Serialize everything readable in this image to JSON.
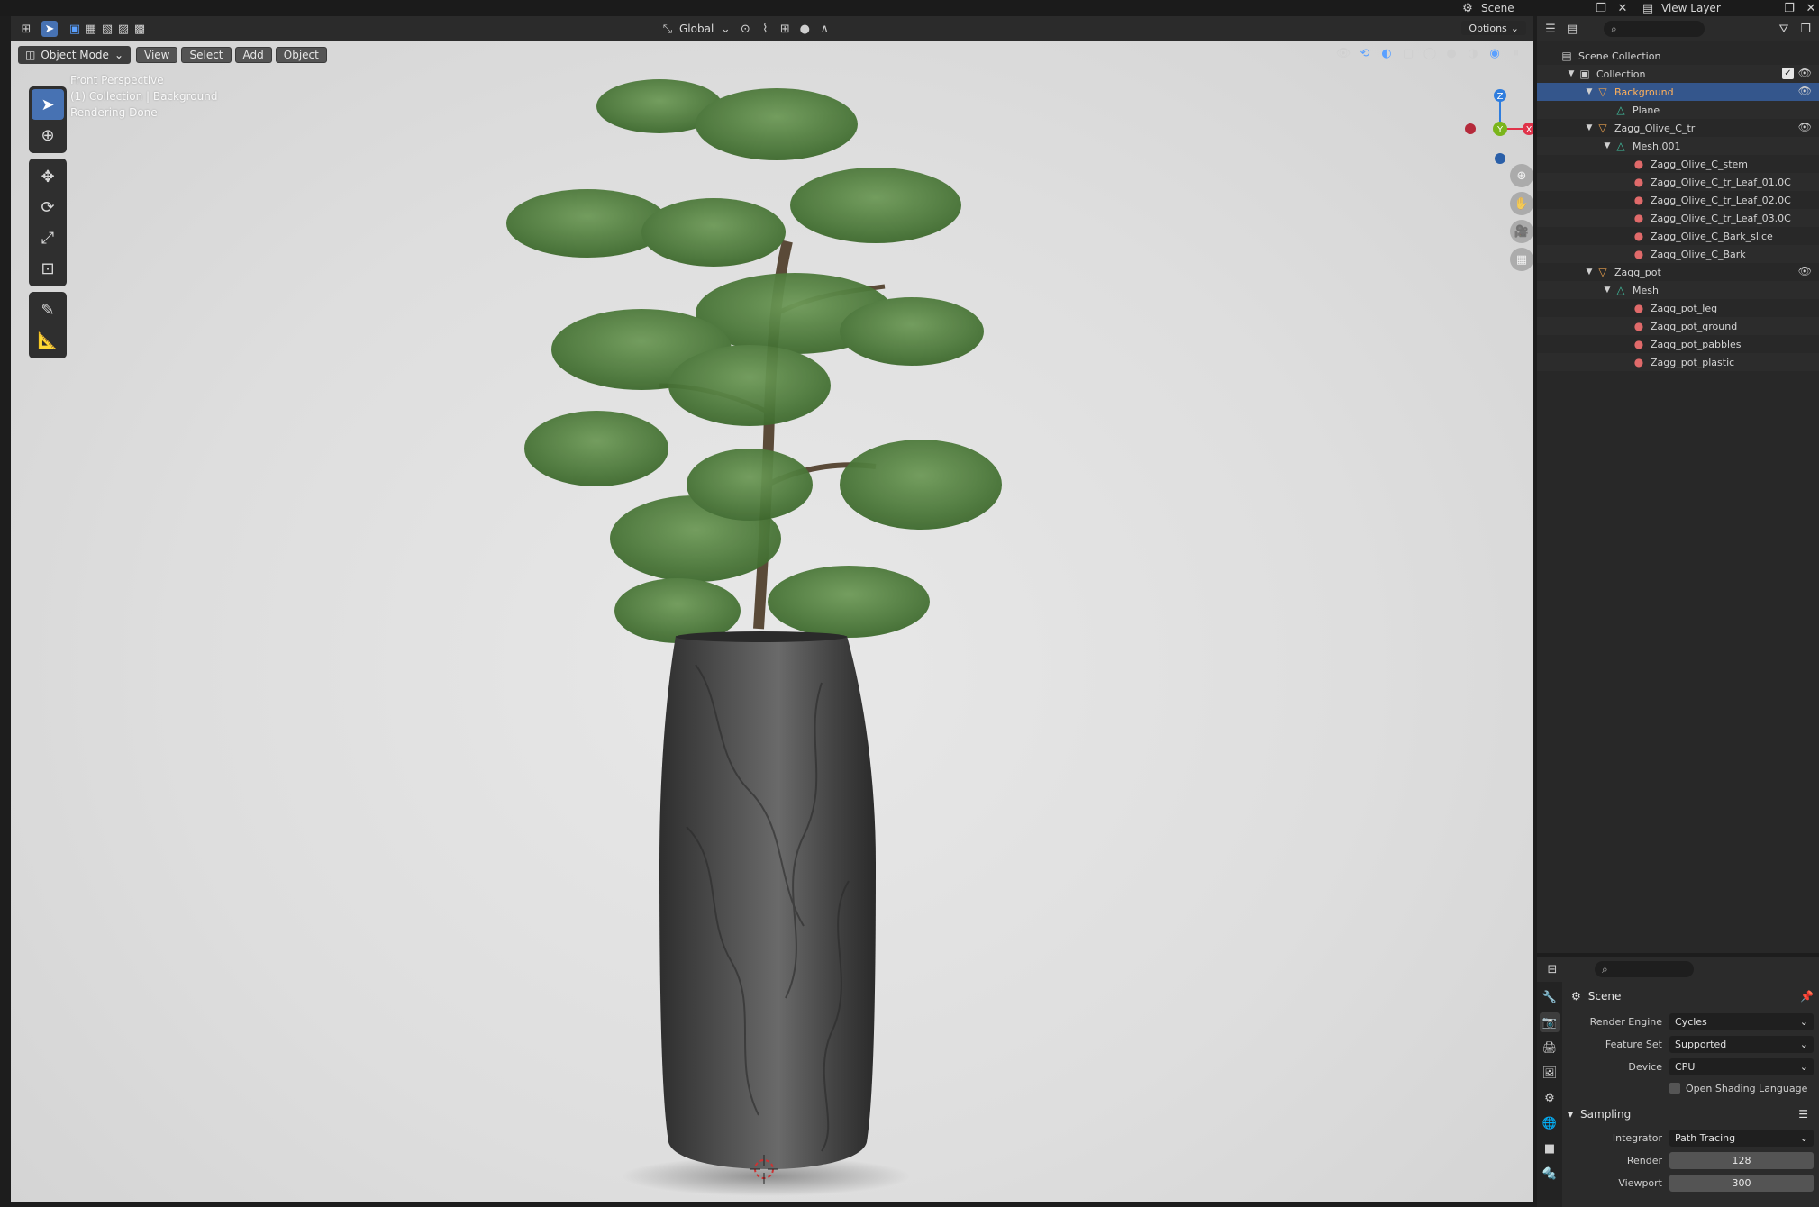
{
  "topbar": {
    "scene_label": "Scene",
    "view_layer_label": "View Layer"
  },
  "viewport_header": {
    "transform_orientation": "Global",
    "options_label": "Options",
    "mode_label": "Object Mode",
    "menus": [
      "View",
      "Select",
      "Add",
      "Object"
    ]
  },
  "viewport_info": {
    "line1": "Front Perspective",
    "line2": "(1) Collection | Background",
    "line3": "Rendering Done"
  },
  "gizmo": {
    "z_label": "Z",
    "y_label": "Y",
    "x_label": "X",
    "colors": {
      "x": "#e0334a",
      "y": "#7ab51b",
      "z": "#2f7dde"
    }
  },
  "outliner": {
    "search_placeholder": "",
    "items": [
      {
        "label": "Scene Collection",
        "type": "scene-collection",
        "depth": 0
      },
      {
        "label": "Collection",
        "type": "collection",
        "depth": 1,
        "checked": true,
        "visible": true
      },
      {
        "label": "Background",
        "type": "object",
        "depth": 2,
        "selected": true,
        "visible": true
      },
      {
        "label": "Plane",
        "type": "mesh",
        "depth": 3
      },
      {
        "label": "Zagg_Olive_C_tr",
        "type": "object",
        "depth": 2,
        "visible": true
      },
      {
        "label": "Mesh.001",
        "type": "mesh",
        "depth": 3
      },
      {
        "label": "Zagg_Olive_C_stem",
        "type": "material",
        "depth": 4
      },
      {
        "label": "Zagg_Olive_C_tr_Leaf_01.0C",
        "type": "material",
        "depth": 4
      },
      {
        "label": "Zagg_Olive_C_tr_Leaf_02.0C",
        "type": "material",
        "depth": 4
      },
      {
        "label": "Zagg_Olive_C_tr_Leaf_03.0C",
        "type": "material",
        "depth": 4
      },
      {
        "label": "Zagg_Olive_C_Bark_slice",
        "type": "material",
        "depth": 4
      },
      {
        "label": "Zagg_Olive_C_Bark",
        "type": "material",
        "depth": 4
      },
      {
        "label": "Zagg_pot",
        "type": "object",
        "depth": 2,
        "visible": true
      },
      {
        "label": "Mesh",
        "type": "mesh",
        "depth": 3
      },
      {
        "label": "Zagg_pot_leg",
        "type": "material",
        "depth": 4
      },
      {
        "label": "Zagg_pot_ground",
        "type": "material",
        "depth": 4
      },
      {
        "label": "Zagg_pot_pabbles",
        "type": "material",
        "depth": 4
      },
      {
        "label": "Zagg_pot_plastic",
        "type": "material",
        "depth": 4
      }
    ]
  },
  "properties": {
    "context_title": "Scene",
    "render_engine_label": "Render Engine",
    "render_engine_value": "Cycles",
    "feature_set_label": "Feature Set",
    "feature_set_value": "Supported",
    "device_label": "Device",
    "device_value": "CPU",
    "osl_label": "Open Shading Language",
    "sampling_label": "Sampling",
    "integrator_label": "Integrator",
    "integrator_value": "Path Tracing",
    "render_samples_label": "Render",
    "render_samples_value": "128",
    "viewport_samples_label": "Viewport",
    "viewport_samples_value": "300"
  }
}
